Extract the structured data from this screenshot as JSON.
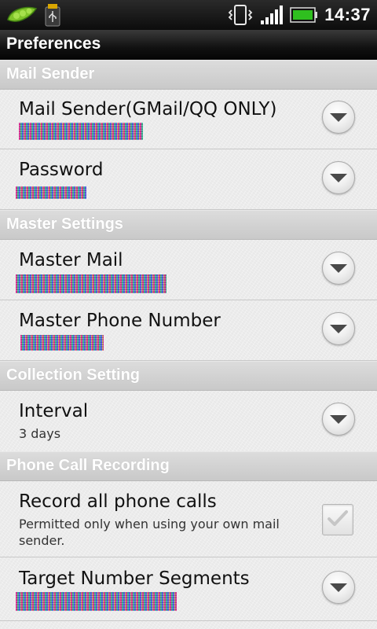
{
  "status_bar": {
    "time": "14:37",
    "icons": [
      "pea-pod-icon",
      "usb-icon",
      "vibrate-icon",
      "signal-icon",
      "battery-icon"
    ],
    "battery_color": "#2fbf1f"
  },
  "title": "Preferences",
  "sections": {
    "mail_sender": {
      "header": "Mail Sender",
      "mail_sender": {
        "title": "Mail Sender(GMail/QQ ONLY)"
      },
      "password": {
        "title": "Password"
      }
    },
    "master_settings": {
      "header": "Master Settings",
      "master_mail": {
        "title": "Master Mail"
      },
      "master_phone": {
        "title": "Master Phone Number"
      }
    },
    "collection_setting": {
      "header": "Collection Setting",
      "interval": {
        "title": "Interval",
        "summary": "3 days"
      }
    },
    "phone_call_recording": {
      "header": "Phone Call Recording",
      "record_all": {
        "title": "Record all phone calls",
        "summary": "Permitted only when using your own mail sender.",
        "checked": true
      },
      "target_segments": {
        "title": "Target Number Segments"
      }
    }
  },
  "colors": {
    "section_header_text": "#ffffff",
    "title_bar": "#111111",
    "row_text": "#111111"
  }
}
